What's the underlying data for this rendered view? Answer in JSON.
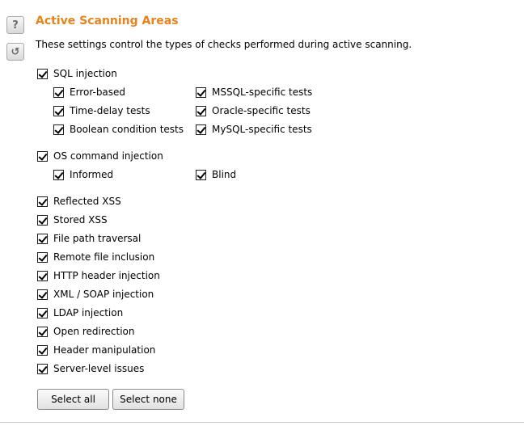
{
  "side": {
    "help_glyph": "?",
    "refresh_glyph": "↺"
  },
  "title": "Active Scanning Areas",
  "description": "These settings control the types of checks performed during active scanning.",
  "sql": {
    "label": "SQL injection",
    "checked": true,
    "error_based": "Error-based",
    "time_delay": "Time-delay tests",
    "boolean": "Boolean condition tests",
    "mssql": "MSSQL-specific tests",
    "oracle": "Oracle-specific tests",
    "mysql": "MySQL-specific tests"
  },
  "os": {
    "label": "OS command injection",
    "checked": true,
    "informed": "Informed",
    "blind": "Blind"
  },
  "checks": [
    {
      "label": "Reflected XSS",
      "checked": true
    },
    {
      "label": "Stored XSS",
      "checked": true
    },
    {
      "label": "File path traversal",
      "checked": true
    },
    {
      "label": "Remote file inclusion",
      "checked": true
    },
    {
      "label": "HTTP header injection",
      "checked": true
    },
    {
      "label": "XML / SOAP injection",
      "checked": true
    },
    {
      "label": "LDAP injection",
      "checked": true
    },
    {
      "label": "Open redirection",
      "checked": true
    },
    {
      "label": "Header manipulation",
      "checked": true
    },
    {
      "label": "Server-level issues",
      "checked": true
    }
  ],
  "buttons": {
    "select_all": "Select all",
    "select_none": "Select none"
  }
}
